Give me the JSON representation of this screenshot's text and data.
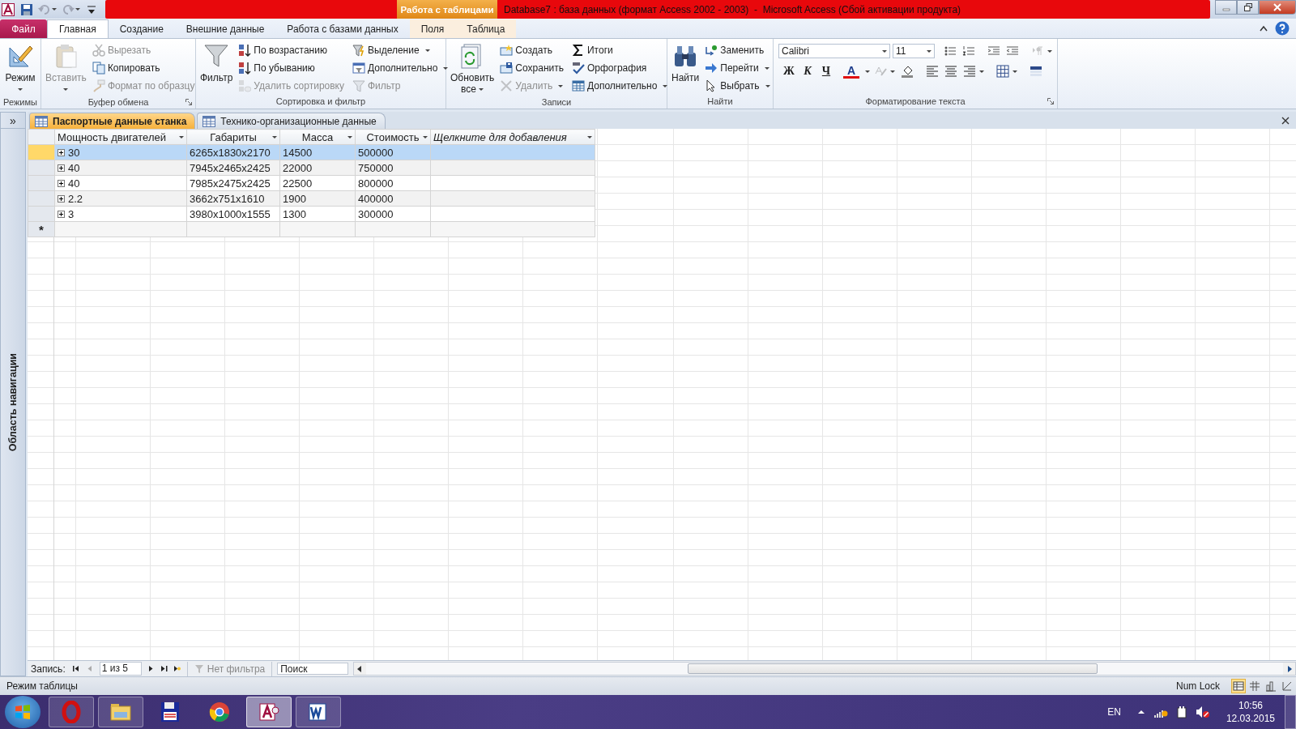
{
  "title_bar": {
    "title": "Database7 : база данных (формат Access 2002 - 2003)  -  Microsoft Access (Сбой активации продукта)",
    "context_label": "Работа с таблицами"
  },
  "quick_access": [
    {
      "disabled": false
    },
    {
      "disabled": true
    },
    {
      "disabled": true
    },
    {
      "disabled": false
    }
  ],
  "ribbon_tabs": [
    {
      "label": "Файл",
      "kind": "file",
      "selected": false
    },
    {
      "label": "Главная",
      "kind": "normal",
      "selected": true
    },
    {
      "label": "Создание",
      "kind": "normal",
      "selected": false
    },
    {
      "label": "Внешние данные",
      "kind": "normal",
      "selected": false
    },
    {
      "label": "Работа с базами данных",
      "kind": "normal",
      "selected": false
    },
    {
      "label": "Поля",
      "kind": "context",
      "selected": false
    },
    {
      "label": "Таблица",
      "kind": "context",
      "selected": false
    }
  ],
  "ribbon_groups": [
    {
      "title": "Режимы",
      "launcher": false,
      "items": [
        {
          "label": "Режим",
          "kind": "large",
          "dropdown": true,
          "disabled": false
        }
      ]
    },
    {
      "title": "Буфер обмена",
      "launcher": true,
      "items": [
        {
          "label": "Вставить",
          "kind": "large",
          "dropdown": true,
          "disabled": true
        },
        {
          "label": "Вырезать",
          "kind": "small",
          "dropdown": false,
          "disabled": true
        },
        {
          "label": "Копировать",
          "kind": "small",
          "dropdown": false,
          "disabled": false
        },
        {
          "label": "Формат по образцу",
          "kind": "small",
          "dropdown": false,
          "disabled": true
        }
      ]
    },
    {
      "title": "Сортировка и фильтр",
      "launcher": false,
      "items": [
        {
          "label": "Фильтр",
          "kind": "large",
          "dropdown": false,
          "disabled": false
        },
        {
          "label": "По возрастанию",
          "kind": "small",
          "dropdown": false,
          "disabled": false
        },
        {
          "label": "По убыванию",
          "kind": "small",
          "dropdown": false,
          "disabled": false
        },
        {
          "label": "Удалить сортировку",
          "kind": "small",
          "dropdown": false,
          "disabled": true
        },
        {
          "label": "Выделение",
          "kind": "small",
          "dropdown": true,
          "disabled": false
        },
        {
          "label": "Дополнительно",
          "kind": "small",
          "dropdown": true,
          "disabled": false
        },
        {
          "label": "Фильтр",
          "kind": "small",
          "dropdown": false,
          "disabled": true
        }
      ]
    },
    {
      "title": "Записи",
      "launcher": false,
      "items": [
        {
          "label": "Обновить все",
          "kind": "large",
          "dropdown": true,
          "disabled": false
        },
        {
          "label": "Создать",
          "kind": "small",
          "dropdown": false,
          "disabled": false
        },
        {
          "label": "Сохранить",
          "kind": "small",
          "dropdown": false,
          "disabled": false
        },
        {
          "label": "Удалить",
          "kind": "small",
          "dropdown": true,
          "disabled": true
        },
        {
          "label": "Итоги",
          "kind": "small",
          "dropdown": false,
          "disabled": false
        },
        {
          "label": "Орфография",
          "kind": "small",
          "dropdown": false,
          "disabled": false
        },
        {
          "label": "Дополнительно",
          "kind": "small",
          "dropdown": true,
          "disabled": false
        }
      ]
    },
    {
      "title": "Найти",
      "launcher": false,
      "items": [
        {
          "label": "Найти",
          "kind": "large",
          "dropdown": false,
          "disabled": false
        },
        {
          "label": "Заменить",
          "kind": "small",
          "dropdown": false,
          "disabled": false
        },
        {
          "label": "Перейти",
          "kind": "small",
          "dropdown": true,
          "disabled": false
        },
        {
          "label": "Выбрать",
          "kind": "small",
          "dropdown": true,
          "disabled": false
        }
      ]
    }
  ],
  "format_group": {
    "title": "Форматирование текста",
    "launcher": true,
    "row1": [
      {
        "kind": "font",
        "value": "Calibri"
      },
      {
        "kind": "size",
        "value": "11"
      },
      {
        "kind": "icon",
        "disabled": false
      },
      {
        "kind": "icon",
        "disabled": false
      },
      {
        "kind": "icon",
        "disabled": false
      },
      {
        "kind": "icon",
        "disabled": false
      },
      {
        "kind": "icon",
        "disabled": true
      }
    ],
    "row2": [
      {
        "kind": "bold",
        "label": "Ж"
      },
      {
        "kind": "italic",
        "label": "К"
      },
      {
        "kind": "underline",
        "label": "Ч"
      },
      {
        "kind": "fontcolor",
        "label": "A"
      },
      {
        "kind": "icon",
        "disabled": true
      },
      {
        "kind": "icon",
        "disabled": false
      },
      {
        "kind": "icon",
        "disabled": false
      },
      {
        "kind": "icon",
        "disabled": false
      },
      {
        "kind": "icon",
        "disabled": false
      },
      {
        "kind": "icon",
        "disabled": false
      },
      {
        "kind": "icon",
        "disabled": false
      }
    ]
  },
  "navigation_pane": {
    "toggle": "»",
    "title": "Область навигации"
  },
  "object_tabs": [
    {
      "label": "Паспортные данные станка",
      "selected": true
    },
    {
      "label": "Технико-организационные данные",
      "selected": false
    }
  ],
  "datasheet": {
    "columns": [
      {
        "label": "Мощность двигателей",
        "kind": "field"
      },
      {
        "label": "Габариты",
        "kind": "field"
      },
      {
        "label": "Масса",
        "kind": "field"
      },
      {
        "label": "Стоимость",
        "kind": "field"
      },
      {
        "label": "Щелкните для добавления",
        "kind": "add"
      }
    ],
    "rows": [
      {
        "cells": [
          "30",
          "6265x1830x2170",
          "14500",
          "500000"
        ],
        "selected": true
      },
      {
        "cells": [
          "40",
          "7945x2465x2425",
          "22000",
          "750000"
        ],
        "selected": false
      },
      {
        "cells": [
          "40",
          "7985x2475x2425",
          "22500",
          "800000"
        ],
        "selected": false
      },
      {
        "cells": [
          "2.2",
          "3662x751x1610",
          "1900",
          "400000"
        ],
        "selected": false
      },
      {
        "cells": [
          "3",
          "3980x1000x1555",
          "1300",
          "300000"
        ],
        "selected": false
      }
    ],
    "new_row_marker": "*"
  },
  "record_navigator": {
    "label": "Запись:",
    "position": "1 из 5",
    "filter": "Нет фильтра",
    "filter_active": false,
    "search_placeholder": "Поиск"
  },
  "status_bar": {
    "mode": "Режим таблицы",
    "indicator": "Num Lock",
    "views": [
      {
        "selected": true
      },
      {
        "selected": false
      },
      {
        "selected": false
      },
      {
        "selected": false
      }
    ]
  },
  "taskbar": {
    "apps": [
      {
        "running": true,
        "active": false
      },
      {
        "running": true,
        "active": false
      },
      {
        "running": false,
        "active": false
      },
      {
        "running": false,
        "active": false
      },
      {
        "running": true,
        "active": true
      },
      {
        "running": true,
        "active": false
      }
    ],
    "language": "EN",
    "time": "10:56",
    "date": "12.03.2015"
  }
}
